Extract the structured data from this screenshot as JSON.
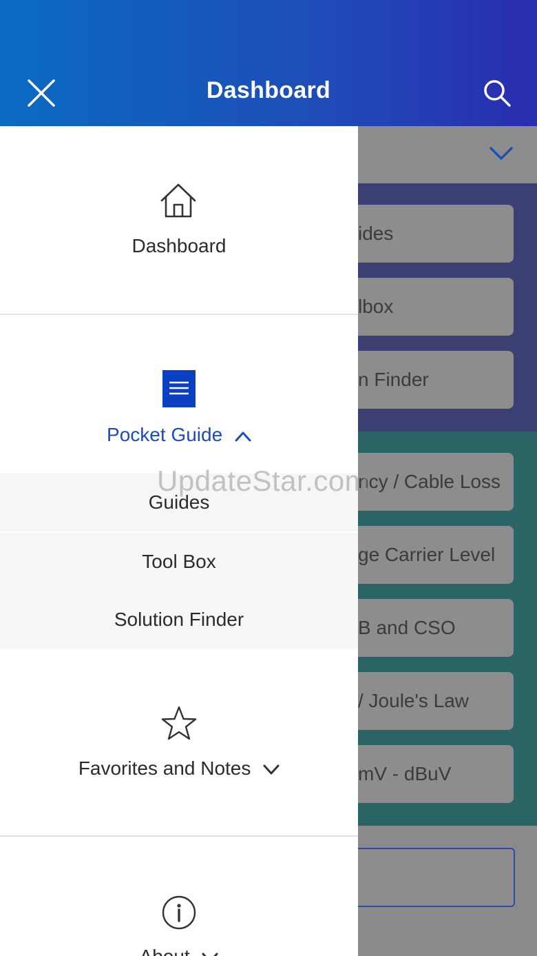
{
  "header": {
    "title": "Dashboard",
    "close_icon": "close-icon",
    "search_icon": "search-icon"
  },
  "background": {
    "cards_blue": [
      "Guides",
      "Toolbox",
      "Solution Finder"
    ],
    "cards_blue_visible": [
      "ides",
      "lbox",
      "n Finder"
    ],
    "cards_teal_visible": [
      "ncy / Cable Loss",
      "ge Carrier Level",
      "B and CSO",
      "/ Joule's Law",
      "mV - dBuV"
    ]
  },
  "drawer": {
    "dashboard": {
      "icon": "home-icon",
      "label": "Dashboard"
    },
    "pocket_guide": {
      "icon": "menu-list-icon",
      "label": "Pocket Guide",
      "expanded": true,
      "items": [
        "Guides",
        "Tool Box",
        "Solution Finder"
      ]
    },
    "favorites": {
      "icon": "star-icon",
      "label": "Favorites and Notes",
      "expanded": false
    },
    "about": {
      "icon": "info-icon",
      "label": "About",
      "expanded": false
    }
  },
  "watermark": "UpdateStar.com",
  "colors": {
    "header_start": "#0a6bc2",
    "header_end": "#2a2db0",
    "accent_blue": "#1a4cc0",
    "icon_blue_fill": "#0b3fc4",
    "dim_blue": "#3b3f72",
    "dim_teal": "#2a6464"
  }
}
